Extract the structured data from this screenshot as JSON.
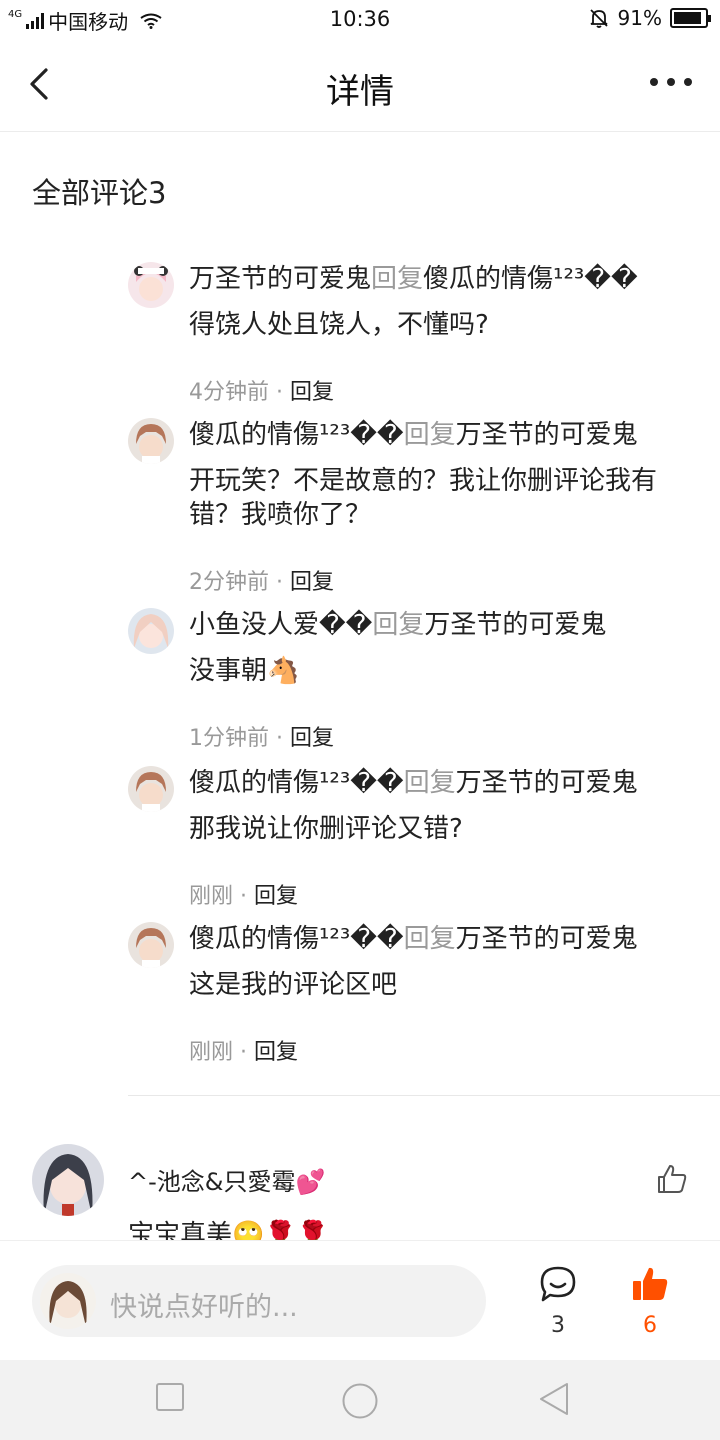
{
  "status_bar": {
    "network_type": "4G",
    "carrier": "中国移动",
    "time": "10:36",
    "battery": "91%",
    "battery_level": 0.91,
    "icons": [
      "signal-icon",
      "wifi-icon",
      "alarm-off-icon",
      "battery-icon"
    ]
  },
  "header": {
    "title": "详情",
    "back_icon": "back-icon",
    "more_icon": "more-icon"
  },
  "section_title": "全部评论3",
  "replies": [
    {
      "user": "万圣节的可爱鬼",
      "reply_word": "回复",
      "target": "傻瓜的情傷¹²³��",
      "text": "得饶人处且饶人，不懂吗?",
      "time": "4分钟前",
      "action": "回复"
    },
    {
      "user": "傻瓜的情傷¹²³��",
      "reply_word": "回复",
      "target": "万圣节的可爱鬼",
      "text": "开玩笑？不是故意的？我让你删评论我有错？我喷你了？",
      "time": "2分钟前",
      "action": "回复"
    },
    {
      "user": "小鱼没人爱��",
      "reply_word": "回复",
      "target": "万圣节的可爱鬼",
      "text": "没事朝🐴",
      "time": "1分钟前",
      "action": "回复"
    },
    {
      "user": "傻瓜的情傷¹²³��",
      "reply_word": "回复",
      "target": "万圣节的可爱鬼",
      "text": "那我说让你删评论又错?",
      "time": "刚刚",
      "action": "回复"
    },
    {
      "user": "傻瓜的情傷¹²³��",
      "reply_word": "回复",
      "target": "万圣节的可爱鬼",
      "text": "这是我的评论区吧",
      "time": "刚刚",
      "action": "回复"
    }
  ],
  "comment": {
    "user": "^-池念&只愛霉💕",
    "text": "宝宝真美🙄🌹🌹"
  },
  "input_bar": {
    "placeholder": "快说点好听的...",
    "comment_count": "3",
    "like_count": "6",
    "accent_color": "#ff5000"
  },
  "nav_bar": {
    "icons": [
      "recent-apps-icon",
      "home-icon",
      "back-nav-icon"
    ]
  }
}
